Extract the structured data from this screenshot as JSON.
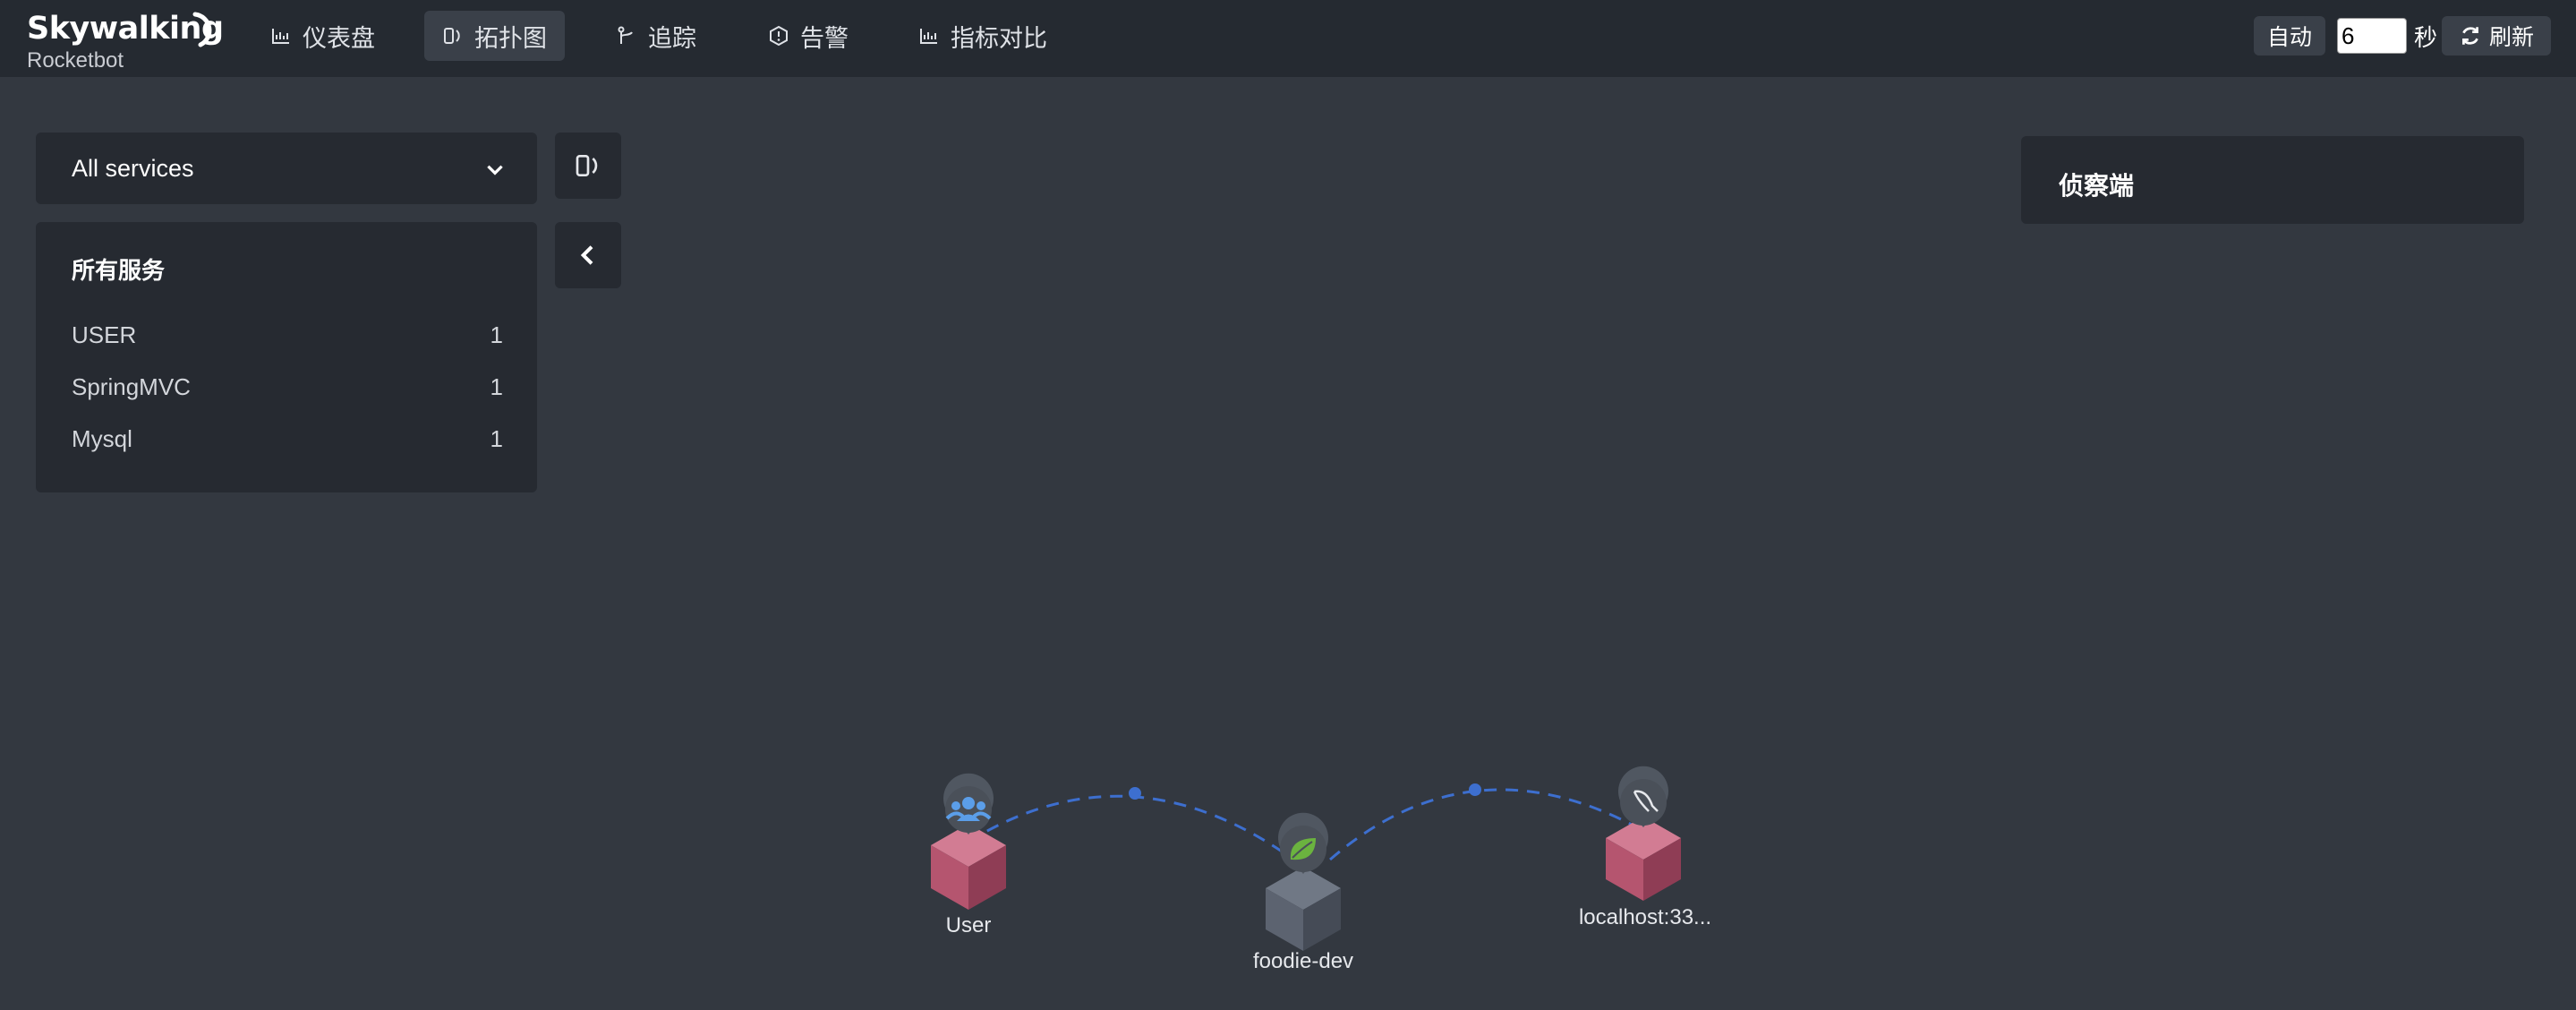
{
  "header": {
    "logo_brand": "Skywalking",
    "logo_sub": "Rocketbot",
    "nav": [
      {
        "label": "仪表盘",
        "icon": "chart-icon"
      },
      {
        "label": "拓扑图",
        "icon": "topology-icon",
        "active": true
      },
      {
        "label": "追踪",
        "icon": "trace-icon"
      },
      {
        "label": "告警",
        "icon": "alert-icon"
      },
      {
        "label": "指标对比",
        "icon": "chart-icon"
      }
    ],
    "auto_label": "自动",
    "interval_value": "6",
    "seconds_label": "秒",
    "refresh_label": "刷新"
  },
  "sidebar": {
    "service_select": {
      "value": "All services"
    },
    "services_title": "所有服务",
    "services": [
      {
        "name": "USER",
        "count": "1"
      },
      {
        "name": "SpringMVC",
        "count": "1"
      },
      {
        "name": "Mysql",
        "count": "1"
      }
    ]
  },
  "detector_panel": {
    "title": "侦察端"
  },
  "topology": {
    "nodes": [
      {
        "label": "User",
        "type": "USER",
        "icon": "users-icon"
      },
      {
        "label": "foodie-dev",
        "type": "SpringMVC",
        "icon": "spring-leaf-icon"
      },
      {
        "label": "localhost:33...",
        "type": "Mysql",
        "icon": "mysql-dolphin-icon"
      }
    ]
  },
  "colors": {
    "background": "#333840",
    "topbar": "#252a31",
    "panel": "#262a31",
    "edge": "#3d6fcf",
    "node_pink": "#b5556f",
    "node_gray": "#5c6370"
  }
}
